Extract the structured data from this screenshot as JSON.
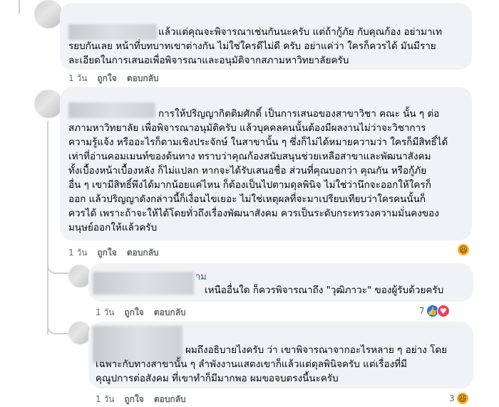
{
  "comments": [
    {
      "text": "แล้วแต่คุณจะพิจารณาเช่นกันนะครับ แต่ถ้ากู้ภัย กับคุณก้อง อย่ามาเท\nรยบกันเลย หน้าที่บทบาทเขาต่างกัน ไม่ใช่ใครดีไม่ดี ครับ อย่าแค่ว่า ใครก็ควรได้ มันมีราย\nละเอียดในการเสนอเพื่อพิจารณาและอนุมัติจากสภามหาวิทยาลัยครับ",
      "time": "1 วัน",
      "like": "ถูกใจ",
      "reply": "ตอบกลับ"
    },
    {
      "text": "การให้ปริญญากิตติมศักดิ์ เป็นการเสนอของสาขาวิชา คณะ นั้น ๆ ต่อ\nสภามหาวิทยาลัย เพื่อพิจารณาอนุมัติครับ แล้วบุคคลคนนั้นต้องมีผลงานไม่ว่าจะวิชาการ\nความรู้แจ้ง หรืออะไรก็ตามเชิงประจักษ์ ในสาขานั้น ๆ ซึ่งก็ไม่ได้หมายความว่า ใครก็มีสิทธิ์ได้\nเท่าที่อ่านคอมเมนท์ของต้นทาง ทราบว่าคุณก้องสนับสนุนช่วยเหลือสาขาและพัฒนาสังคม\nทั้งเบื้องหน้าเบื้องหลัง ก็ไม่แปลก หากจะได้รับเสนอชื่อ ส่วนที่คุณบอกว่า คุณกัน หรือกู้ภัย\nอื่น ๆ เขามีสิทธิ์พึงได้มากน้อยแค่ไหน ก็ต้องเป็นไปตามดุลพินิจ ไม่ใช่ว่านึกจะออกให้ใครก็\nออก แล้วปริญญาดังกล่าวนี้ก็เงื่อนไขเยอะ ไม่ใช่เหตุผลที่จะมาเปรียบเทียบว่าใครคนนั้นก็\nควรได้ เพราะถ้าจะให้ได้โดยทั่วถึงเรื่องพัฒนาสังคม ควรเป็นระดับกระทรวงความมั่นคงของ\nมนุษย์ออกให้แล้วครับ",
      "time": "1 วัน",
      "like": "ถูกใจ",
      "reply": "ตอบกลับ"
    }
  ],
  "replies": [
    {
      "name_fragment": "าม",
      "text": "เหนืออื่นใด ก็ควรพิจารณาถึง \"วุฒิภาวะ\" ของผู้รับด้วยครับ",
      "time": "1 วัน",
      "like": "ถูกใจ",
      "reply": "ตอบกลับ",
      "reaction_count": "7"
    },
    {
      "text": "ผมถึงอธิบายไงครับ ว่า เขาพิจารณาจากอะไรหลาย ๆ อย่าง โดย\nเฉพาะกับทางสาขานั้น ๆ ลำพังงานแสดงเขาก็แล้วแต่ดุลพินิจครับ แต่เรื่องที่มี\nคุณูปการต่อสังคม ที่เขาทำก็มีมากพอ ผมขอจบตรงนี้นะครับ",
      "time": "1 วัน",
      "like": "ถูกใจ",
      "reply": "ตอบกลับ",
      "reaction_count": "3"
    }
  ],
  "icons": {
    "like": "👍",
    "love": "♥",
    "haha": "😆"
  }
}
